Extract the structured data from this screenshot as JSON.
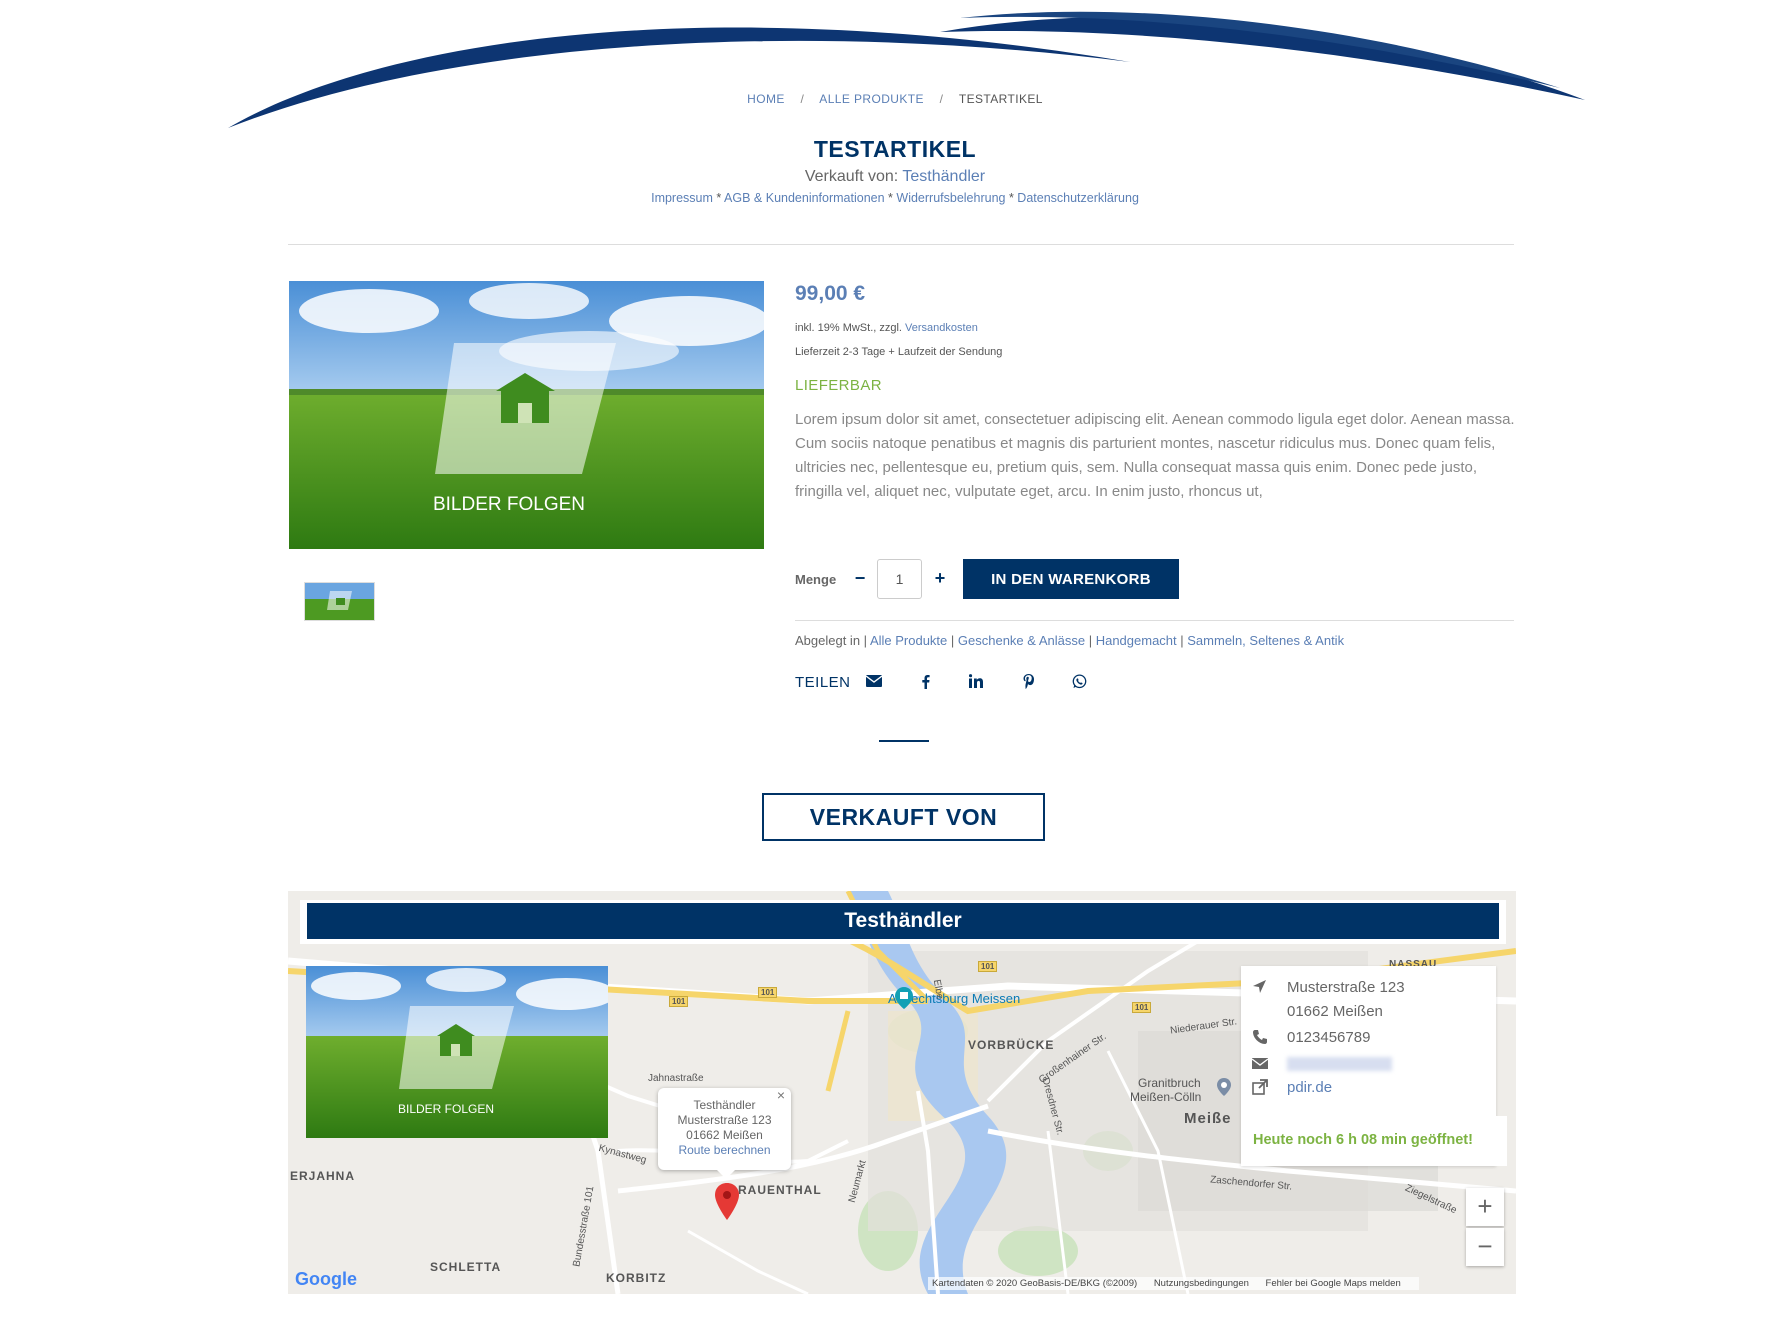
{
  "breadcrumb": {
    "home": "HOME",
    "all_products": "ALLE PRODUKTE",
    "current": "TESTARTIKEL",
    "sep": "/"
  },
  "product": {
    "title": "TESTARTIKEL",
    "sold_by_prefix": "Verkauft von: ",
    "vendor_name": "Testhändler",
    "legal_links": [
      "Impressum",
      "AGB & Kundeninformationen",
      "Widerrufsbelehrung",
      "Datenschutzerklärung"
    ],
    "legal_sep": " * ",
    "price": "99,00 €",
    "tax_prefix": "inkl. 19% MwSt., zzgl. ",
    "tax_link": "Versandkosten",
    "delivery": "Lieferzeit 2-3 Tage + Laufzeit der Sendung",
    "stock": "LIEFERBAR",
    "description": "Lorem ipsum dolor sit amet, consectetuer adipiscing elit. Aenean commodo ligula eget dolor. Aenean massa. Cum sociis natoque penatibus et magnis dis parturient montes, nascetur ridiculus mus. Donec quam felis, ultricies nec, pellentesque eu, pretium quis, sem. Nulla consequat massa quis enim. Donec pede justo, fringilla vel, aliquet nec, vulputate eget, arcu. In enim justo, rhoncus ut,",
    "image_caption": "BILDER  FOLGEN"
  },
  "cart": {
    "qty_label": "Menge",
    "minus": "−",
    "plus": "+",
    "qty_value": "1",
    "add_to_cart": "IN DEN WARENKORB"
  },
  "categories": {
    "prefix": "Abgelegt in",
    "items": [
      "Alle Produkte",
      "Geschenke & Anlässe",
      "Handgemacht",
      "Sammeln, Seltenes & Antik"
    ]
  },
  "share": {
    "label": "TEILEN",
    "icons": [
      "envelope-icon",
      "facebook-icon",
      "linkedin-icon",
      "pinterest-icon",
      "whatsapp-icon"
    ]
  },
  "sold_by_section": {
    "heading": "VERKAUFT VON",
    "vendor_bar": "Testhändler",
    "image_caption": "BILDER  FOLGEN",
    "address_line1": "Musterstraße 123",
    "address_line2": "01662 Meißen",
    "phone": "0123456789",
    "website": "pdir.de",
    "open_status": "Heute noch 6 h 08 min geöffnet!"
  },
  "map": {
    "popup_name": "Testhändler",
    "popup_street": "Musterstraße 123",
    "popup_city": "01662 Meißen",
    "popup_route": "Route berechnen",
    "popup_close": "×",
    "zoom_in": "+",
    "zoom_out": "−",
    "google_logo": "Google",
    "footer_data": "Kartendaten © 2020 GeoBasis-DE/BKG (©2009)",
    "footer_terms": "Nutzungsbedingungen",
    "footer_report": "Fehler bei Google Maps melden",
    "labels": {
      "albrechtsburg": "Albrechtsburg Meissen",
      "vorbrucke": "VORBRÜCKE",
      "granitbruch": "Granitbruch",
      "meissen_colln": "Meißen-Cölln",
      "meissen": "Meiße",
      "rauenthal": "RAUENTHAL",
      "erjahna": "ERJAHNA",
      "schletta": "SCHLETTA",
      "korbitz": "KORBITZ",
      "nassau": "NASSAU",
      "jahnastrasse": "Jahnastraße",
      "kynastweg": "Kynastweg",
      "neumarkt": "Neumarkt",
      "zaschendorfer": "Zaschendorfer Str.",
      "ziegelstrasse": "Ziegelstraße",
      "niederauer": "Niederauer Str.",
      "grossenhainer": "Großenhainer Str.",
      "dresdner": "Dresdner Str.",
      "elbe": "Elbe",
      "bundesstrasse": "Bundesstraße 101",
      "b101": "101"
    }
  },
  "colors": {
    "navy": "#003366",
    "link": "#5b7fb5",
    "green": "#7cb342"
  }
}
